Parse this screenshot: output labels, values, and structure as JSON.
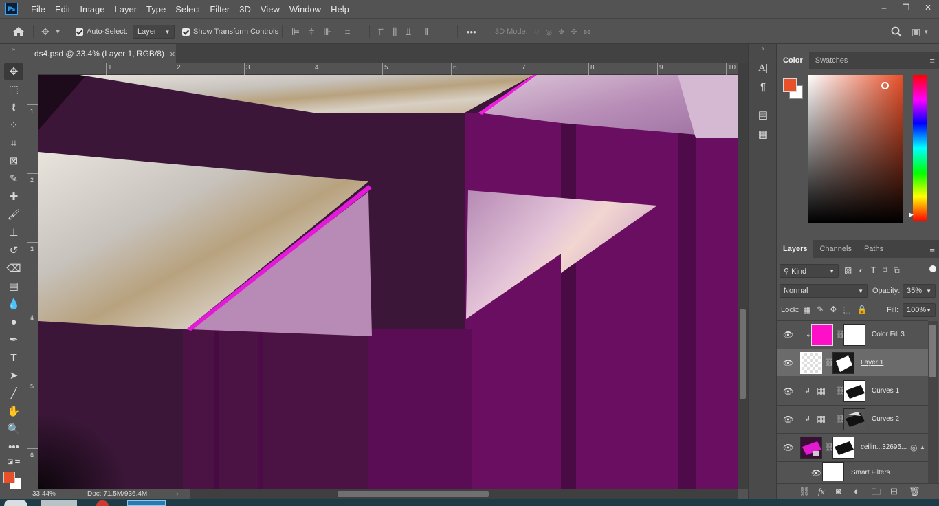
{
  "app": {
    "logo": "Ps",
    "menus": [
      "File",
      "Edit",
      "Image",
      "Layer",
      "Type",
      "Select",
      "Filter",
      "3D",
      "View",
      "Window",
      "Help"
    ],
    "window_controls": {
      "minimize": "–",
      "restore": "❐",
      "close": "✕"
    }
  },
  "options_bar": {
    "auto_select_label": "Auto-Select:",
    "auto_select_target": "Layer",
    "show_transform_label": "Show Transform Controls",
    "more": "•••",
    "mode_3d_label": "3D Mode:"
  },
  "document": {
    "tab_title": "ds4.psd @ 33.4% (Layer 1, RGB/8)",
    "close": "×",
    "zoom": "33.44%",
    "doc_size": "Doc: 71.5M/936.4M"
  },
  "rulers": {
    "horizontal": [
      "1",
      "2",
      "3",
      "4",
      "5",
      "6",
      "7",
      "8",
      "9",
      "10"
    ],
    "vertical": [
      [
        "1",
        "1"
      ],
      [
        "1",
        "2"
      ],
      [
        "1",
        "3"
      ],
      [
        "1",
        "4"
      ],
      [
        "1",
        "5"
      ],
      [
        "1",
        "6"
      ]
    ]
  },
  "color_panel": {
    "tabs": [
      "Color",
      "Swatches"
    ],
    "foreground": "#e8502a",
    "background": "#ffffff"
  },
  "layers_panel": {
    "tabs": [
      "Layers",
      "Channels",
      "Paths"
    ],
    "filter_kind": "Kind",
    "blend_mode": "Normal",
    "opacity_label": "Opacity:",
    "opacity": "35%",
    "lock_label": "Lock:",
    "fill_label": "Fill:",
    "fill": "100%",
    "layers": [
      {
        "name": "Color Fill 3",
        "visible": true,
        "clipped": true,
        "thumb_color": "#ff0fc8",
        "selected": false
      },
      {
        "name": "Layer 1",
        "visible": true,
        "clipped": false,
        "thumb_color": "checker",
        "selected": true
      },
      {
        "name": "Curves 1",
        "visible": true,
        "clipped": true,
        "thumb_color": "adjust",
        "selected": false
      },
      {
        "name": "Curves 2",
        "visible": true,
        "clipped": true,
        "thumb_color": "adjust",
        "selected": false
      },
      {
        "name": "ceilin...32695...",
        "visible": true,
        "clipped": false,
        "thumb_color": "#8a1470",
        "selected": false
      },
      {
        "name": "Smart Filters",
        "visible": true,
        "clipped": false,
        "thumb_color": "#ffffff",
        "selected": false
      }
    ],
    "footer_icons": [
      "link-icon",
      "fx-icon",
      "mask-icon",
      "adjustment-icon",
      "group-icon",
      "new-layer-icon",
      "trash-icon"
    ]
  }
}
